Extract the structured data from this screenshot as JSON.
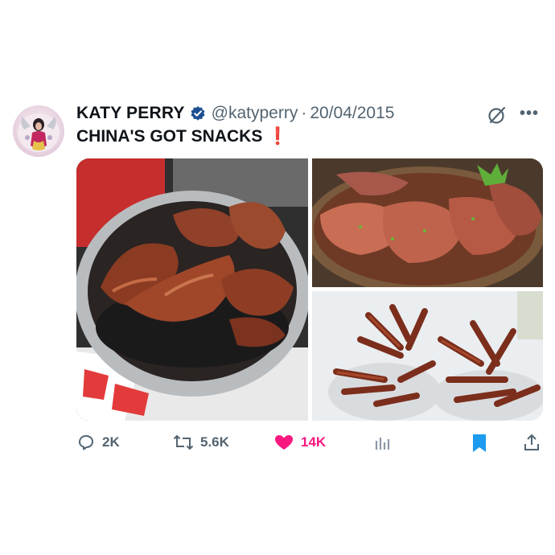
{
  "author": {
    "name": "KATY PERRY",
    "handle": "@katyperry",
    "date": "20/04/2015"
  },
  "tweet": {
    "text": "CHINA'S GOT SNACKS",
    "emoji": "❗"
  },
  "metrics": {
    "replies": "2K",
    "retweets": "5.6K",
    "likes": "14K"
  },
  "icons": [
    "verified-badge-icon",
    "grok-icon",
    "more-icon",
    "reply-icon",
    "retweet-icon",
    "like-icon",
    "views-icon",
    "bookmark-icon",
    "share-icon"
  ],
  "colors": {
    "verified": "#1d4f91",
    "like": "#f91880",
    "bookmark": "#1d9bf0",
    "secondary_text": "#536471"
  }
}
